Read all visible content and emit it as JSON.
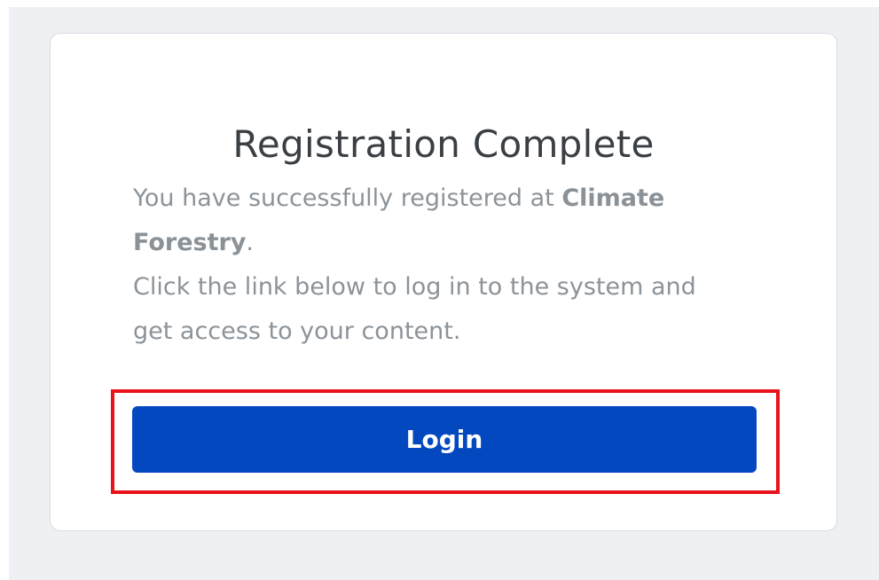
{
  "card": {
    "title": "Registration Complete",
    "message": {
      "line1_prefix": "You have successfully registered at ",
      "brand": "Climate Forestry",
      "line1_suffix": ".",
      "line2": "Click the link below to log in to the system and get access to your content."
    },
    "login_label": "Login"
  },
  "colors": {
    "button": "#0448c0",
    "highlight": "#e8131b",
    "background": "#eef0f4"
  }
}
